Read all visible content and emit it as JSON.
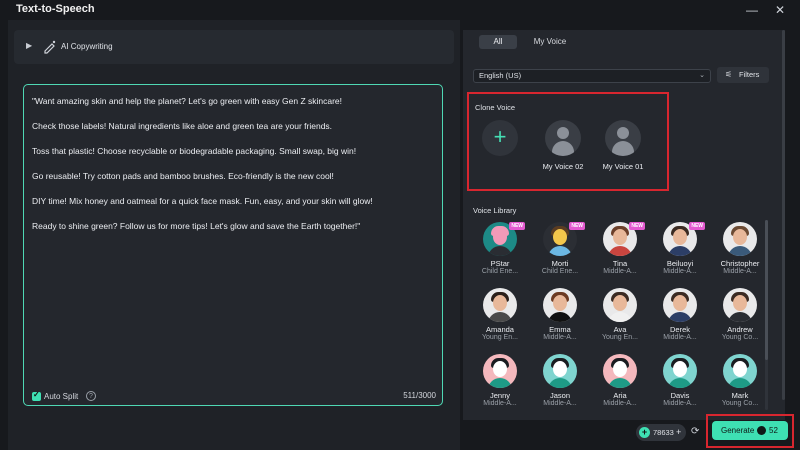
{
  "window": {
    "title": "Text-to-Speech",
    "minimize_icon": "minimize-icon",
    "close_icon": "close-icon"
  },
  "left": {
    "copywriting": {
      "label": "AI Copywriting",
      "icon": "pen-sparkle-icon"
    },
    "editor": {
      "paragraphs": [
        "\"Want amazing skin and help the planet? Let's go green with easy Gen Z skincare!",
        "Check those labels! Natural ingredients like aloe and green tea are your friends.",
        "Toss that plastic! Choose recyclable or biodegradable packaging. Small swap, big win!",
        "Go reusable! Try cotton pads and bamboo brushes. Eco-friendly is the new cool!",
        "DIY time! Mix honey and oatmeal for a quick face mask. Fun, easy, and your skin will glow!",
        "Ready to shine green? Follow us for more tips! Let's glow and save the Earth together!\""
      ],
      "auto_split_label": "Auto Split",
      "auto_split_checked": true,
      "char_count": "511/3000"
    }
  },
  "right": {
    "tabs": [
      {
        "label": "All",
        "active": true
      },
      {
        "label": "My Voice",
        "active": false
      }
    ],
    "language": "English (US)",
    "filters_label": "Filters",
    "clone": {
      "title": "Clone Voice",
      "voices": [
        {
          "name": "My Voice 02"
        },
        {
          "name": "My Voice 01"
        }
      ]
    },
    "library": {
      "title": "Voice Library",
      "voices": [
        {
          "name": "PStar",
          "desc": "Child Ene...",
          "new": true,
          "bg": "#1d8a86",
          "skin": "#f29ab8",
          "hair": "#f29ab8",
          "shirt": "#2a2d33"
        },
        {
          "name": "Morti",
          "desc": "Child Ene...",
          "new": true,
          "bg": "#2b2e34",
          "skin": "#f3c64b",
          "hair": "#5a3c22",
          "shirt": "#6bb7e3"
        },
        {
          "name": "Tina",
          "desc": "Middle-A...",
          "new": true,
          "bg": "#e9e9ea",
          "skin": "#e8b89a",
          "hair": "#6b3f2a",
          "shirt": "#c9453f"
        },
        {
          "name": "Beiluoyi",
          "desc": "Middle-A...",
          "new": true,
          "bg": "#e9e9ea",
          "skin": "#e8b89a",
          "hair": "#3a2a22",
          "shirt": "#2c3e66"
        },
        {
          "name": "Christopher",
          "desc": "Middle-A...",
          "new": false,
          "bg": "#e9e9ea",
          "skin": "#e8b89a",
          "hair": "#6b4a33",
          "shirt": "#3a5a7a"
        },
        {
          "name": "Amanda",
          "desc": "Young En...",
          "new": false,
          "bg": "#e9e9ea",
          "skin": "#e8b89a",
          "hair": "#2a1f1a",
          "shirt": "#4a4a4a"
        },
        {
          "name": "Emma",
          "desc": "Middle-A...",
          "new": false,
          "bg": "#e9e9ea",
          "skin": "#e8b89a",
          "hair": "#6b3a22",
          "shirt": "#111111"
        },
        {
          "name": "Ava",
          "desc": "Young En...",
          "new": false,
          "bg": "#e9e9ea",
          "skin": "#e8b89a",
          "hair": "#3a2a22",
          "shirt": "#f0f0f0"
        },
        {
          "name": "Derek",
          "desc": "Middle-A...",
          "new": false,
          "bg": "#e9e9ea",
          "skin": "#e8b89a",
          "hair": "#3a2a22",
          "shirt": "#2c3e66"
        },
        {
          "name": "Andrew",
          "desc": "Young Co...",
          "new": false,
          "bg": "#e9e9ea",
          "skin": "#e8b89a",
          "hair": "#3a2a22",
          "shirt": "#2a2d33"
        },
        {
          "name": "Jenny",
          "desc": "Middle-A...",
          "new": false,
          "bg": "#f4b8bd",
          "skin": "#ffffff",
          "hair": "#1a1c20",
          "shirt": "#1e9b86"
        },
        {
          "name": "Jason",
          "desc": "Middle-A...",
          "new": false,
          "bg": "#7fd4cf",
          "skin": "#ffffff",
          "hair": "#1a1c20",
          "shirt": "#1e9b86"
        },
        {
          "name": "Aria",
          "desc": "Middle-A...",
          "new": false,
          "bg": "#f4b8bd",
          "skin": "#ffffff",
          "hair": "#1a1c20",
          "shirt": "#1e9b86"
        },
        {
          "name": "Davis",
          "desc": "Middle-A...",
          "new": false,
          "bg": "#7fd4cf",
          "skin": "#ffffff",
          "hair": "#1a1c20",
          "shirt": "#1e9b86"
        },
        {
          "name": "Mark",
          "desc": "Young Co...",
          "new": false,
          "bg": "#7fd4cf",
          "skin": "#ffffff",
          "hair": "#1a1c20",
          "shirt": "#1e9b86"
        }
      ]
    }
  },
  "footer": {
    "credits": "78633",
    "generate_label": "Generate",
    "generate_cost": "52"
  },
  "colors": {
    "accent": "#3ee0b3",
    "highlight": "#d8262f",
    "panel": "#24272d",
    "background": "#17191d"
  }
}
